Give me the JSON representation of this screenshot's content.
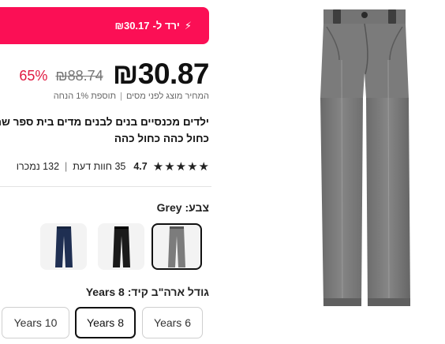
{
  "flash_banner": {
    "icon": "lightning-bolt-icon",
    "label": "ירד ל-",
    "price": "₪30.17"
  },
  "price": {
    "current": "₪30.87",
    "original": "₪88.74",
    "discount": "65%"
  },
  "tax_note": {
    "text": "המחיר מוצג לפני מסים",
    "discount_text": "תוספת 1% הנחה"
  },
  "product": {
    "title": "ילדים מכנסיים בנים לבנים מדים בית ספר שח כחול כהה כחול כהה"
  },
  "rating": {
    "value": "4.7",
    "stars": 5,
    "reviews": "35 חוות דעת",
    "sold": "132 נמכרו"
  },
  "color": {
    "label": "צבע:",
    "selected": "Grey",
    "options": [
      {
        "name": "navy",
        "color": "#1f2f52"
      },
      {
        "name": "black",
        "color": "#1a1a1a"
      },
      {
        "name": "grey",
        "color": "#7c7c7c"
      }
    ]
  },
  "size": {
    "label": "גודל ארה\"ב קיד:",
    "selected": "Years 8",
    "options": [
      "Years 10",
      "Years 8",
      "Years 6"
    ]
  },
  "colors": {
    "accent": "#fb0f55",
    "discount": "#e0173f",
    "trouser_grey": "#7e7e7e"
  }
}
